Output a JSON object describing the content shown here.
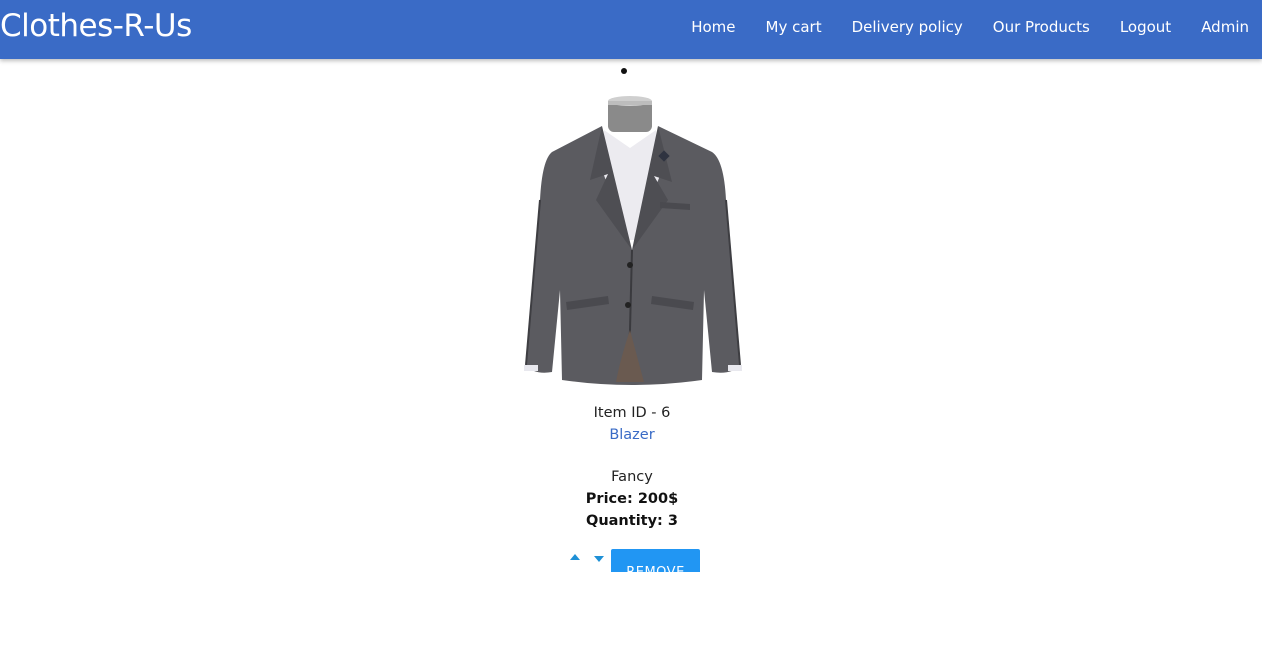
{
  "app": {
    "brand": "Clothes-R-Us",
    "accent_color": "#3a6bc6"
  },
  "nav": {
    "items": [
      {
        "label": "Home"
      },
      {
        "label": "My cart"
      },
      {
        "label": "Delivery policy"
      },
      {
        "label": "Our Products"
      },
      {
        "label": "Logout"
      },
      {
        "label": "Admin"
      }
    ]
  },
  "cart_item": {
    "image_alt": "Blazer",
    "id_label": "Item ID - 6",
    "name": "Blazer",
    "category": "Fancy",
    "price_label": "Price: 200$",
    "quantity_label": "Quantity: 3",
    "remove_label": "REMOVE",
    "button_color": "#2196f3"
  }
}
